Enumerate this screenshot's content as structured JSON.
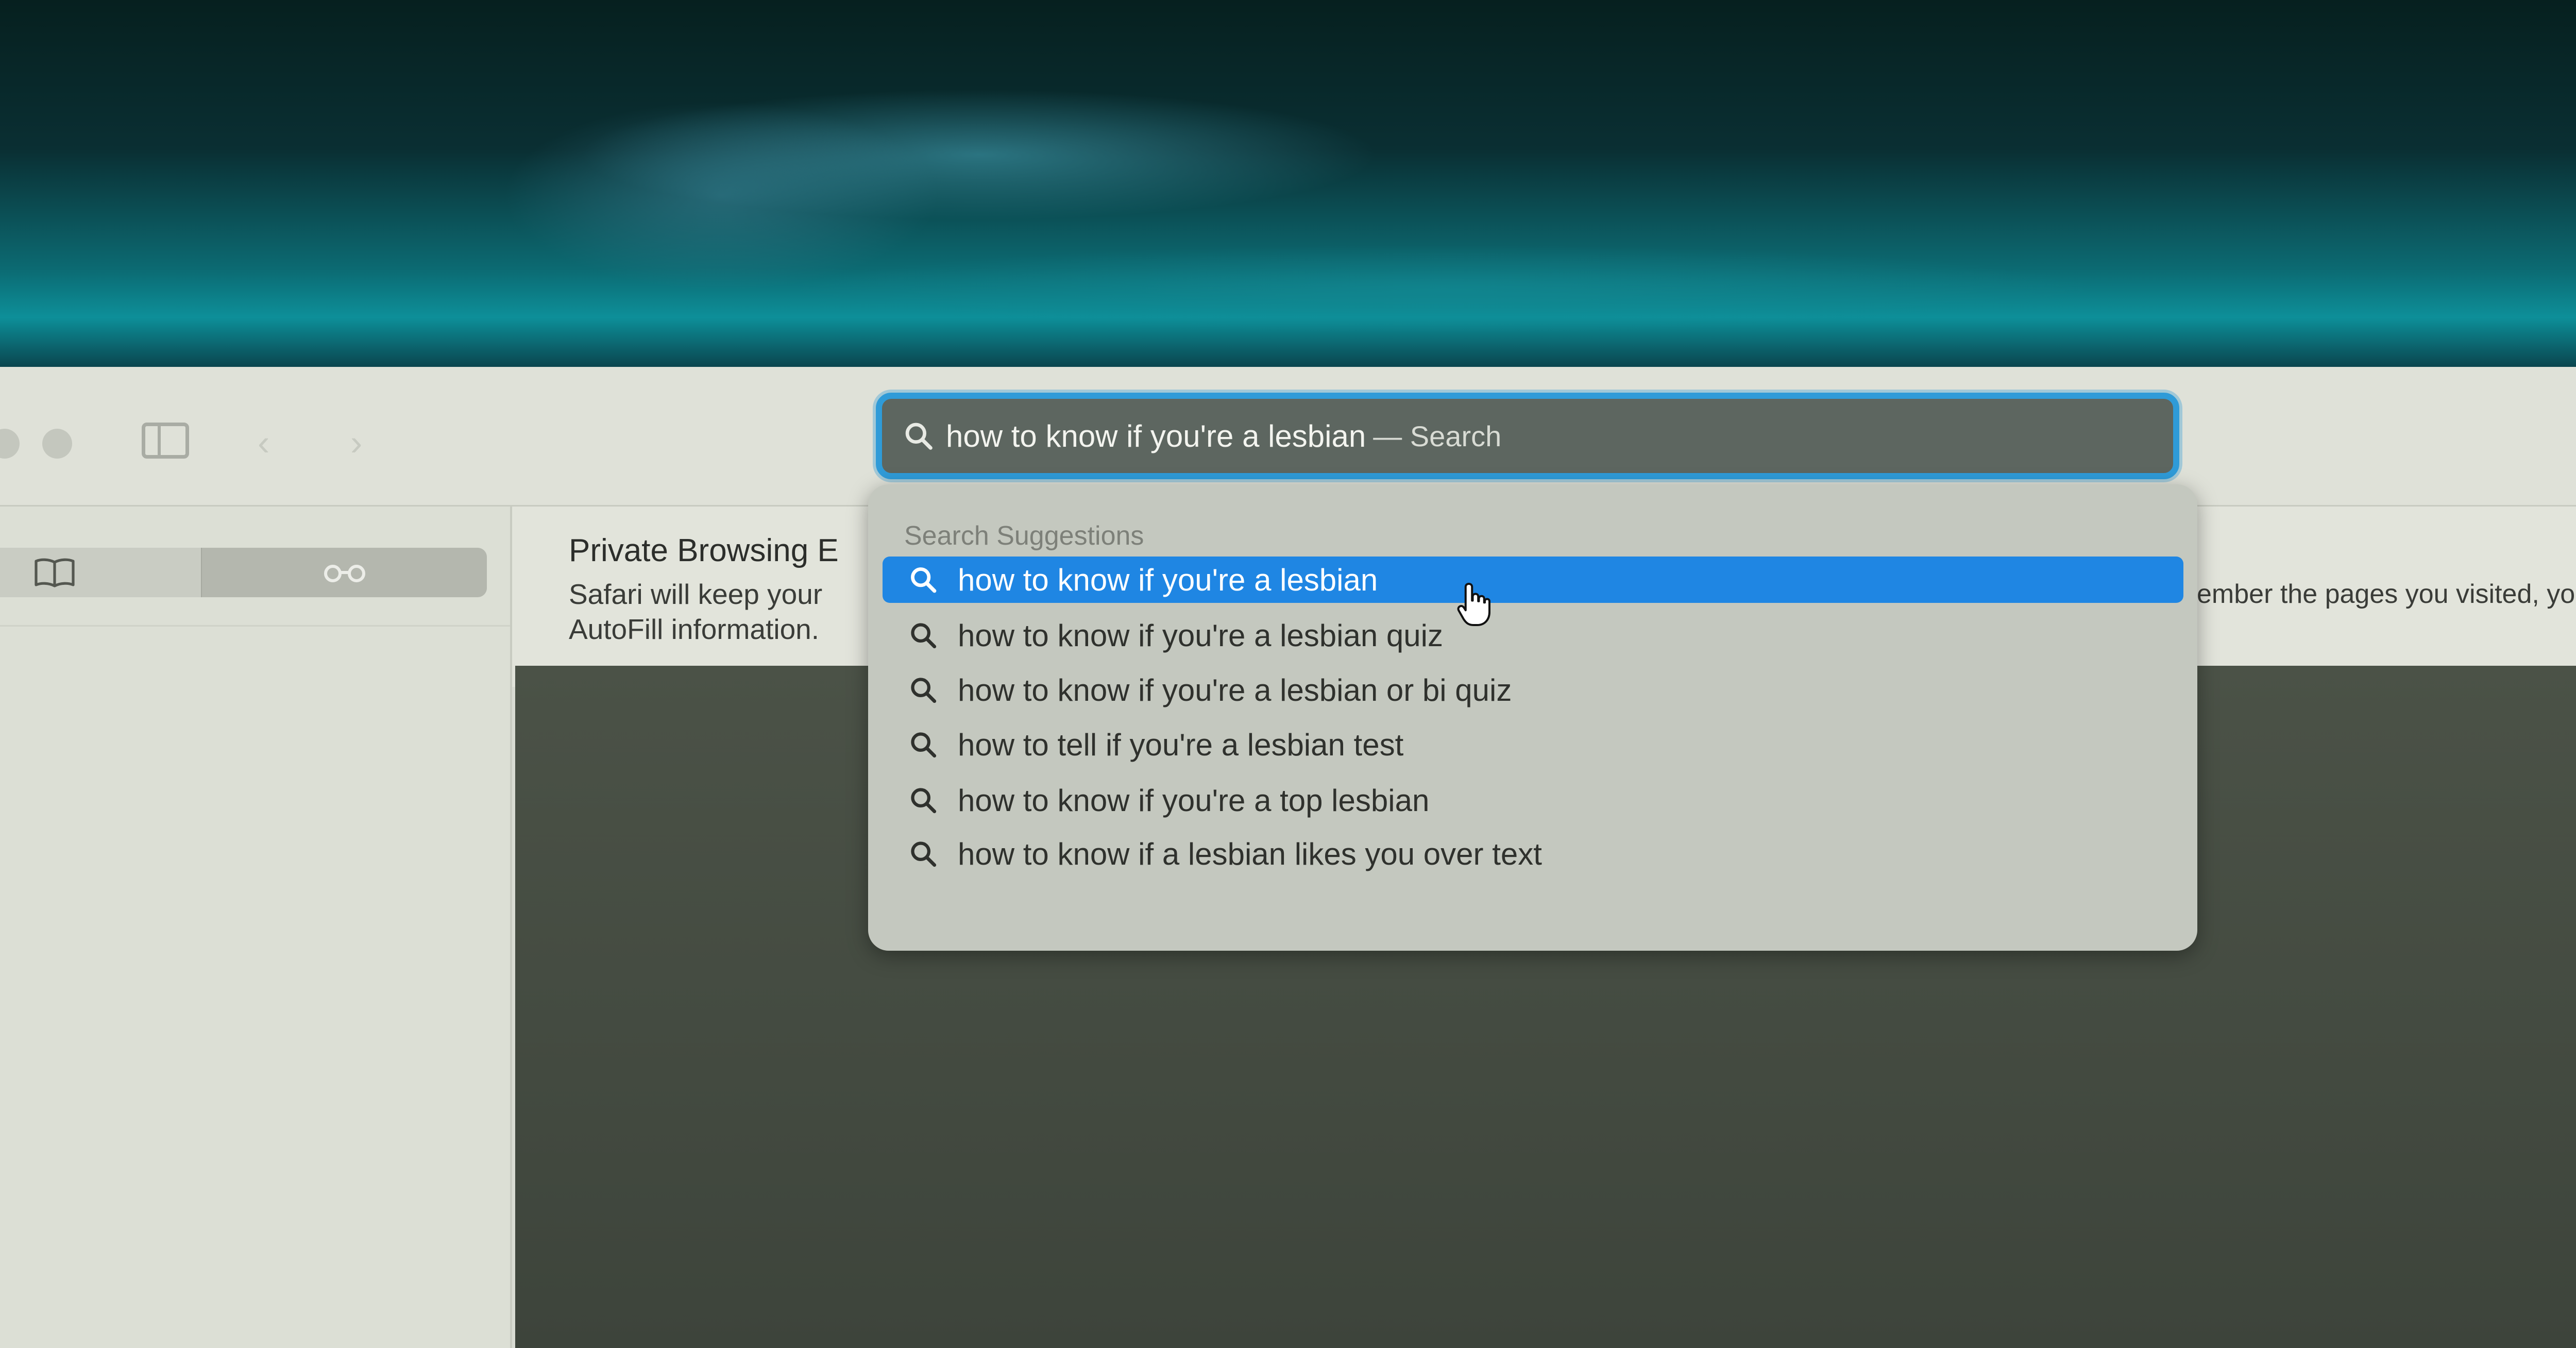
{
  "address_bar": {
    "query": "how to know if you're a lesbian",
    "suffix": "— Search"
  },
  "banner": {
    "title": "Private Browsing E",
    "line1": "Safari will keep your",
    "line2": "AutoFill information.",
    "right_text": "ember the pages you visited, you"
  },
  "dropdown": {
    "header": "Search Suggestions",
    "items": [
      {
        "label": "how to know if you're a lesbian",
        "selected": true
      },
      {
        "label": "how to know if you're a lesbian quiz",
        "selected": false
      },
      {
        "label": "how to know if you're a lesbian or bi quiz",
        "selected": false
      },
      {
        "label": "how to tell if you're a lesbian test",
        "selected": false
      },
      {
        "label": "how to know if you're a top lesbian",
        "selected": false
      },
      {
        "label": "how to know if a lesbian likes you over text",
        "selected": false
      }
    ]
  },
  "icons": {
    "search": "search-icon",
    "sidebar": "sidebar-toggle-icon",
    "back": "chevron-left-icon",
    "forward": "chevron-right-icon",
    "bookmarks": "book-icon",
    "reading_list": "glasses-icon",
    "cursor": "hand-pointer-icon"
  },
  "colors": {
    "accent": "#1f86e3",
    "focus_ring": "#2f9bd8"
  }
}
